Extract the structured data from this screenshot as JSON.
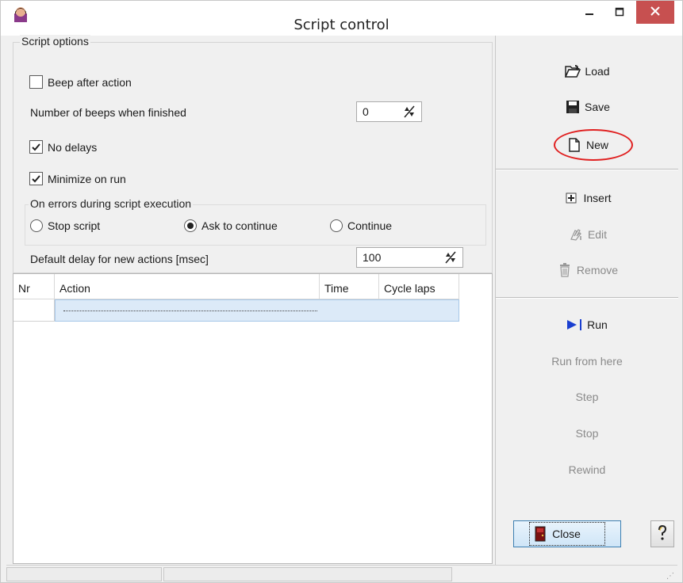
{
  "window": {
    "title": "Script control"
  },
  "options": {
    "group_title": "Script options",
    "beep_after_action": {
      "label": "Beep after action",
      "checked": false
    },
    "beeps_when_finished": {
      "label": "Number of beeps when finished",
      "value": "0"
    },
    "no_delays": {
      "label": "No delays",
      "checked": true
    },
    "minimize_on_run": {
      "label": "Minimize on run",
      "checked": true
    },
    "errors_group": {
      "title": "On errors during script execution",
      "options": [
        {
          "label": "Stop script",
          "selected": false
        },
        {
          "label": "Ask to continue",
          "selected": true
        },
        {
          "label": "Continue",
          "selected": false
        }
      ]
    },
    "default_delay": {
      "label": "Default delay for new actions [msec]",
      "value": "100"
    }
  },
  "table": {
    "columns": [
      "Nr",
      "Action",
      "Time",
      "Cycle laps"
    ],
    "rows": [
      {
        "nr": "",
        "action": "",
        "time": "",
        "cycle_laps": ""
      }
    ]
  },
  "side": {
    "load": "Load",
    "save": "Save",
    "new": "New",
    "insert": "Insert",
    "edit": "Edit",
    "remove": "Remove",
    "run": "Run",
    "run_from_here": "Run from here",
    "step": "Step",
    "stop": "Stop",
    "rewind": "Rewind",
    "close": "Close"
  },
  "colors": {
    "highlight": "#e02020",
    "close_button": "#c75050",
    "selection": "#dceaf8",
    "run_icon": "#1a3fd0"
  }
}
